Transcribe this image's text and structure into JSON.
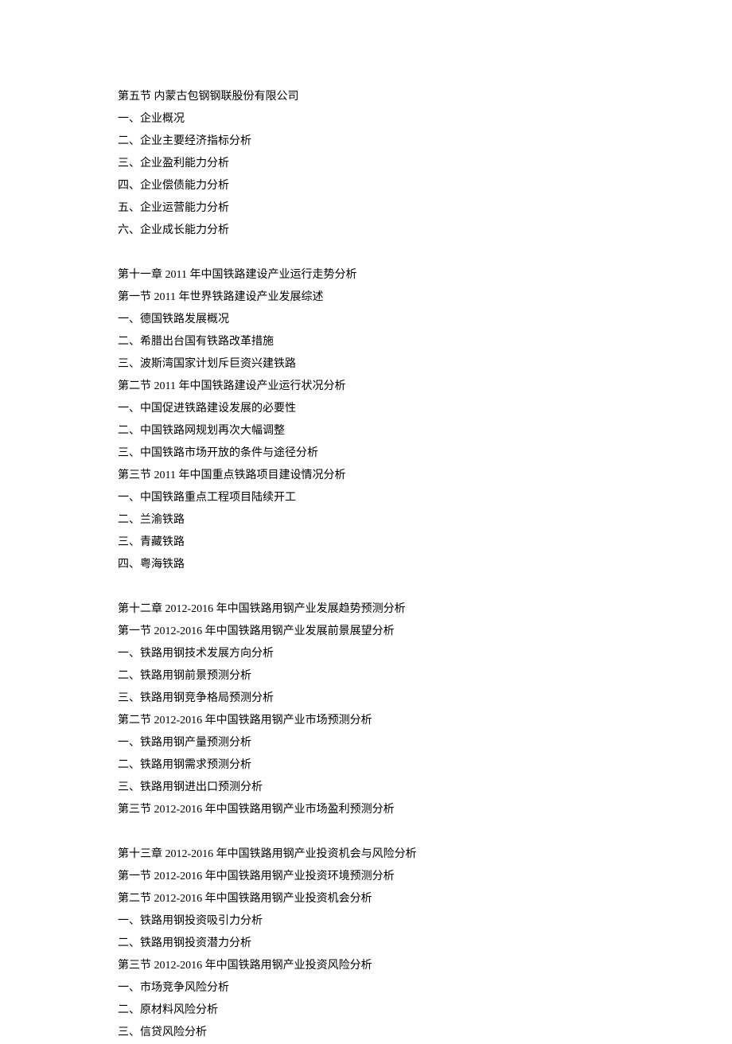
{
  "sections": [
    {
      "lines": [
        "第五节  内蒙古包钢钢联股份有限公司",
        "一、企业概况",
        "二、企业主要经济指标分析",
        "三、企业盈利能力分析",
        "四、企业偿债能力分析",
        "五、企业运营能力分析",
        "六、企业成长能力分析"
      ]
    },
    {
      "lines": [
        "第十一章  2011 年中国铁路建设产业运行走势分析",
        "第一节  2011 年世界铁路建设产业发展综述",
        "一、德国铁路发展概况",
        "二、希腊出台国有铁路改革措施",
        "三、波斯湾国家计划斥巨资兴建铁路",
        "第二节  2011 年中国铁路建设产业运行状况分析",
        "一、中国促进铁路建设发展的必要性",
        "二、中国铁路网规划再次大幅调整",
        "三、中国铁路市场开放的条件与途径分析",
        "第三节  2011 年中国重点铁路项目建设情况分析",
        "一、中国铁路重点工程项目陆续开工",
        "二、兰渝铁路",
        "三、青藏铁路",
        "四、粤海铁路"
      ]
    },
    {
      "lines": [
        "第十二章  2012-2016 年中国铁路用钢产业发展趋势预测分析",
        "第一节  2012-2016 年中国铁路用钢产业发展前景展望分析",
        "一、铁路用钢技术发展方向分析",
        "二、铁路用钢前景预测分析",
        "三、铁路用钢竞争格局预测分析",
        "第二节  2012-2016 年中国铁路用钢产业市场预测分析",
        "一、铁路用钢产量预测分析",
        "二、铁路用钢需求预测分析",
        "三、铁路用钢进出口预测分析",
        "第三节 2012-2016 年中国铁路用钢产业市场盈利预测分析"
      ]
    },
    {
      "lines": [
        "第十三章  2012-2016 年中国铁路用钢产业投资机会与风险分析",
        "第一节 2012-2016 年中国铁路用钢产业投资环境预测分析",
        "第二节 2012-2016 年中国铁路用钢产业投资机会分析",
        "一、铁路用钢投资吸引力分析",
        "二、铁路用钢投资潜力分析",
        "第三节  2012-2016 年中国铁路用钢产业投资风险分析",
        "一、市场竞争风险分析",
        "二、原材料风险分析",
        "三、信贷风险分析"
      ]
    }
  ]
}
